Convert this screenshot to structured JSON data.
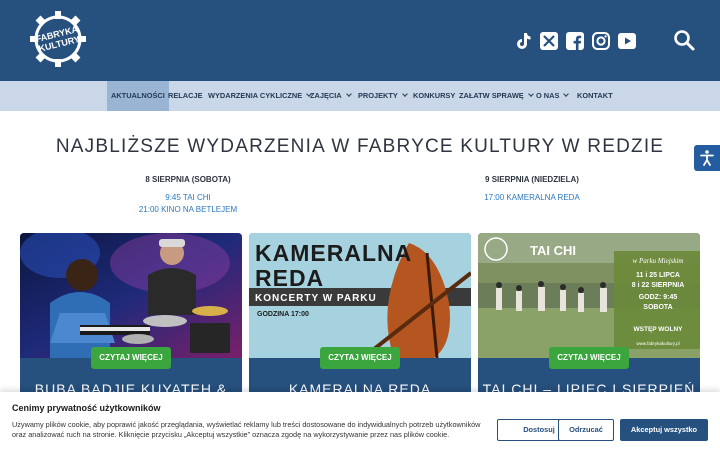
{
  "header": {
    "logo_text": "FABRYKA KULTURY",
    "brand_color": "#26507e",
    "social_icons": [
      "tiktok-icon",
      "x-twitter-icon",
      "facebook-icon",
      "instagram-icon",
      "youtube-icon"
    ],
    "search_icon": "search-icon"
  },
  "nav": {
    "items": [
      {
        "label": "AKTUALNOŚCI",
        "dropdown": false,
        "active": true
      },
      {
        "label": "RELACJE",
        "dropdown": false
      },
      {
        "label": "WYDARZENIA CYKLICZNE",
        "dropdown": true
      },
      {
        "label": "ZAJĘCIA",
        "dropdown": true
      },
      {
        "label": "PROJEKTY",
        "dropdown": true
      },
      {
        "label": "KONKURSY",
        "dropdown": false
      },
      {
        "label": "ZAŁATW SPRAWĘ",
        "dropdown": true
      },
      {
        "label": "O NAS",
        "dropdown": true
      },
      {
        "label": "KONTAKT",
        "dropdown": false
      }
    ]
  },
  "main": {
    "title": "NAJBLIŻSZE WYDARZENIA W FABRYCE KULTURY W REDZIE",
    "days": [
      {
        "date": "8 SIERPNIA (SOBOTA)",
        "events": [
          "9:45 TAI CHI",
          "21:00 KINO NA BETLEJEM"
        ]
      },
      {
        "date": "9 SIERPNIA (NIEDZIELA)",
        "events": [
          "17:00 KAMERALNA REDA"
        ]
      }
    ]
  },
  "cards": [
    {
      "title": "BUBA BADJIE KUYATEH &",
      "button": "CZYTAJ WIĘCEJ"
    },
    {
      "title": "KAMERALNA REDA",
      "button": "CZYTAJ WIĘCEJ",
      "poster": {
        "line1": "KAMERALNA",
        "line2": "REDA",
        "subtitle": "KONCERTY W PARKU",
        "time": "GODZINA 17:00"
      }
    },
    {
      "title": "TAI CHI – LIPIEC I SIERPIEŃ",
      "button": "CZYTAJ WIĘCEJ",
      "poster": {
        "heading": "TAI CHI",
        "place": "w Parku Miejskim",
        "dates1": "11 i 25 LIPCA",
        "dates2": "8 i 22 SIERPNIA",
        "hour": "GODZ: 9:45",
        "day": "SOBOTA",
        "entry": "WSTĘP WOLNY",
        "site": "www.fabrykakultury.pl"
      }
    }
  ],
  "cookie": {
    "title": "Cenimy prywatność użytkowników",
    "text": "Używamy plików cookie, aby poprawić jakość przeglądania, wyświetlać reklamy lub treści dostosowane do indywidualnych potrzeb użytkowników oraz analizować ruch na stronie. Kliknięcie przycisku „Akceptuj wszystkie” oznacza zgodę na wykorzystywanie przez nas plików cookie.",
    "buttons": {
      "customize": "Dostosuj",
      "reject": "Odrzucać",
      "accept": "Akceptuj wszystko"
    }
  },
  "accessibility_icon": "accessibility-icon",
  "colors": {
    "nav_bg": "#c9d7e8",
    "button_green": "#3aa63d",
    "link_blue": "#2b79c0"
  }
}
